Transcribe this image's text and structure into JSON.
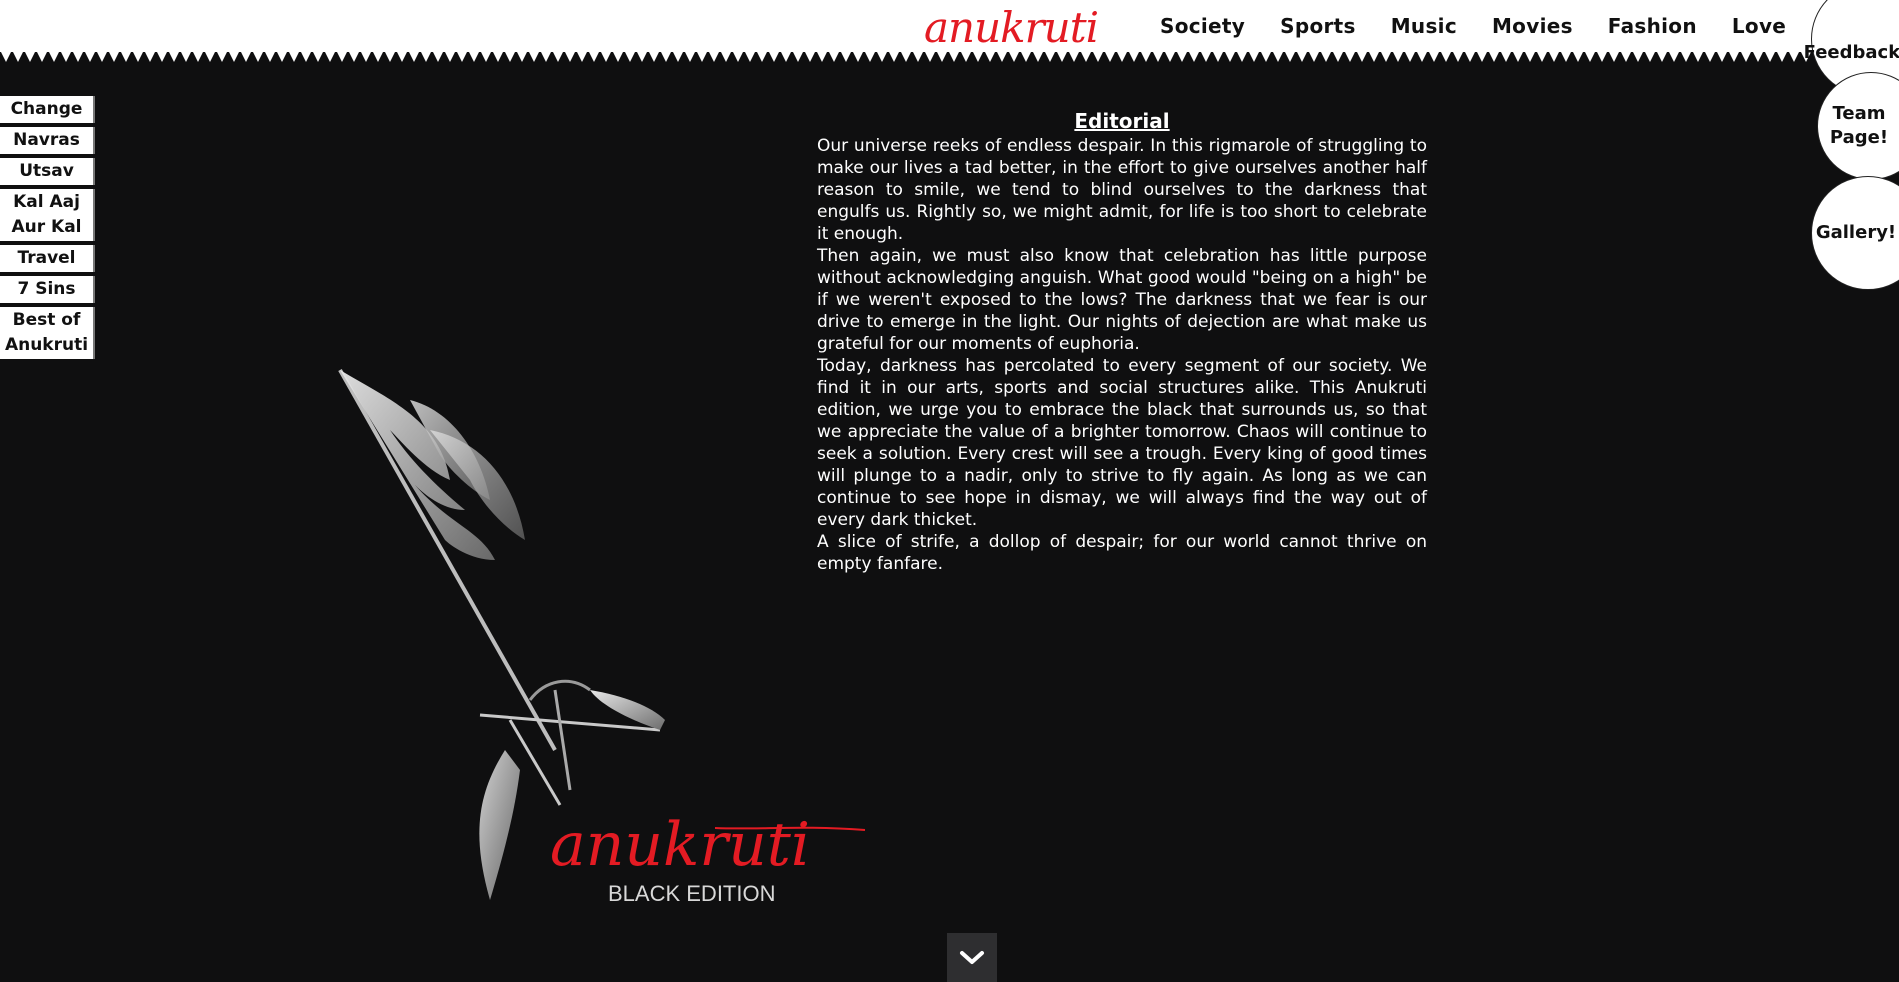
{
  "header": {
    "brand": "anukruti",
    "nav": [
      "Society",
      "Sports",
      "Music",
      "Movies",
      "Fashion",
      "Love"
    ]
  },
  "side_buttons": {
    "feedback": "Feedback!",
    "team_page": "Team Page!",
    "gallery": "Gallery!"
  },
  "leftnav": {
    "items": [
      "Change",
      "Navras",
      "Utsav",
      "Kal Aaj Aur Kal",
      "Travel",
      "7 Sins",
      "Best of Anukruti"
    ]
  },
  "editorial": {
    "title": "Editorial",
    "paragraphs": [
      "Our universe reeks of endless despair. In this rigmarole of struggling to make our lives a tad better, in the effort to give ourselves another half reason to smile, we tend to blind ourselves to the darkness that engulfs us. Rightly so, we might admit, for life is too short to celebrate it enough.",
      "Then again, we must also know that celebration has little purpose without acknowledging anguish. What good would \"being on a high\" be if we weren't exposed to the lows? The darkness that we fear is our drive to emerge in the light. Our nights of dejection are what make us grateful for our moments of euphoria.",
      "Today, darkness has percolated to every segment of our society. We find it in our arts, sports and social structures alike. This Anukruti edition, we urge you to embrace the black that surrounds us, so that we appreciate the value of a brighter tomorrow. Chaos will continue to seek a solution. Every crest will see a trough. Every king of good times will plunge to a nadir, only to strive to fly again. As long as we can continue to see hope in dismay, we will always find the way out of every dark thicket.",
      "A slice of strife, a dollop of despair; for our world cannot thrive on empty fanfare."
    ]
  },
  "artwork": {
    "logo_text": "anukruti",
    "edition": "BLACK EDITION"
  },
  "colors": {
    "background": "#0f0f10",
    "brand_red": "#e31b23",
    "header": "#ffffff"
  },
  "icons": {
    "scroll": "chevron-down-icon"
  }
}
